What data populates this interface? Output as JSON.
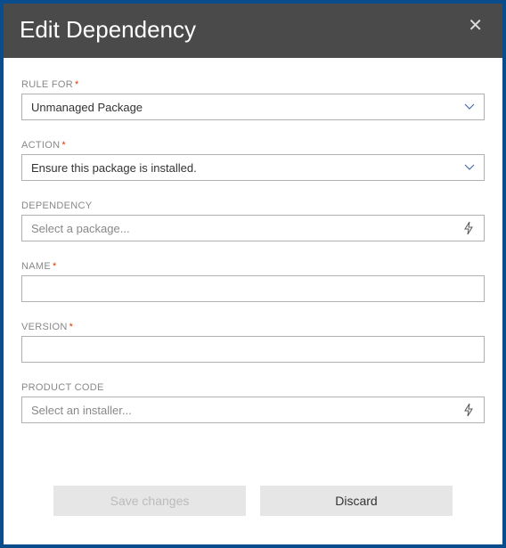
{
  "header": {
    "title": "Edit Dependency"
  },
  "fields": {
    "rule_for": {
      "label": "RULE FOR",
      "required": "*",
      "value": "Unmanaged Package"
    },
    "action": {
      "label": "ACTION",
      "required": "*",
      "value": "Ensure this package is installed."
    },
    "dependency": {
      "label": "DEPENDENCY",
      "placeholder": "Select a package..."
    },
    "name": {
      "label": "NAME",
      "required": "*",
      "value": ""
    },
    "version": {
      "label": "VERSION",
      "required": "*",
      "value": ""
    },
    "product_code": {
      "label": "PRODUCT CODE",
      "placeholder": "Select an installer..."
    }
  },
  "buttons": {
    "save": "Save changes",
    "discard": "Discard"
  }
}
